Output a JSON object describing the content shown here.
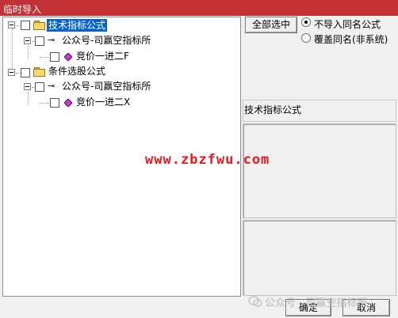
{
  "window": {
    "title": "临时导入"
  },
  "tree": {
    "groups": [
      {
        "label": "技术指标公式",
        "selected": true,
        "child": {
          "label": "公众号-司赢空指标所",
          "leaf": "竞价一进二F"
        }
      },
      {
        "label": "条件选股公式",
        "selected": false,
        "child": {
          "label": "公众号-司赢空指标所",
          "leaf": "竞价一进二X"
        }
      }
    ]
  },
  "controls": {
    "select_all": "全部选中",
    "radio_skip": "不导入同名公式",
    "radio_overwrite": "覆盖同名(非系统)",
    "selected_radio": "radio_skip"
  },
  "info": {
    "type_label": "技术指标公式"
  },
  "footer": {
    "ok": "确定",
    "cancel": "取消"
  },
  "watermarks": {
    "center": "www.zbzfwu.com",
    "bottom": "公众号 · 司赢空指标所"
  },
  "colors": {
    "title_bar": "#c33136",
    "selection": "#0a64c8",
    "watermark": "#e8191f"
  }
}
